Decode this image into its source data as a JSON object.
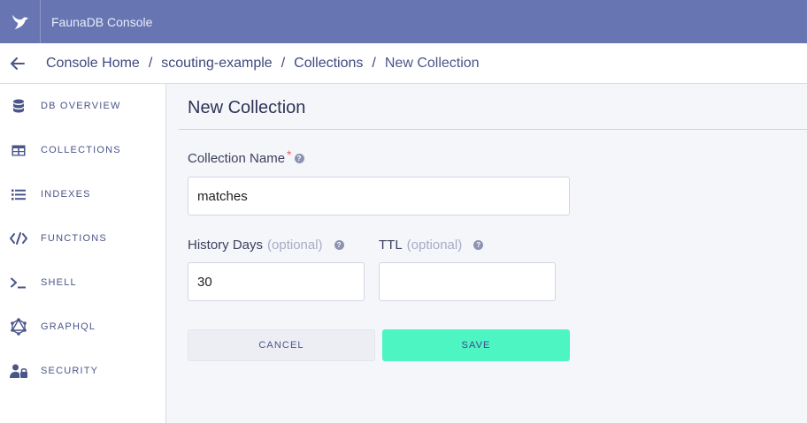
{
  "app": {
    "title": "FaunaDB Console"
  },
  "breadcrumb": [
    "Console Home",
    "scouting-example",
    "Collections",
    "New Collection"
  ],
  "sidebar": {
    "items": [
      {
        "label": "DB OVERVIEW",
        "icon": "database-icon"
      },
      {
        "label": "COLLECTIONS",
        "icon": "table-icon"
      },
      {
        "label": "INDEXES",
        "icon": "list-icon"
      },
      {
        "label": "FUNCTIONS",
        "icon": "code-icon"
      },
      {
        "label": "SHELL",
        "icon": "terminal-icon"
      },
      {
        "label": "GRAPHQL",
        "icon": "graphql-icon"
      },
      {
        "label": "SECURITY",
        "icon": "user-lock-icon"
      }
    ]
  },
  "form": {
    "title": "New Collection",
    "name_label": "Collection Name",
    "required_mark": "*",
    "name_value": "matches",
    "history_label": "History Days",
    "history_optional": "(optional)",
    "history_value": "30",
    "ttl_label": "TTL",
    "ttl_optional": "(optional)",
    "ttl_value": "",
    "help_glyph": "?",
    "cancel_label": "CANCEL",
    "save_label": "SAVE"
  },
  "colors": {
    "topbar": "#6776b2",
    "save_button": "#4cf5c2",
    "accent_text": "#3f4a7f"
  }
}
